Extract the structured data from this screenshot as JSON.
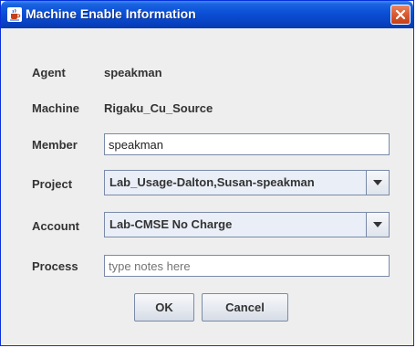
{
  "window": {
    "title": "Machine Enable Information"
  },
  "icons": {
    "title_icon": "java-cup-icon",
    "close": "close-icon",
    "dropdown": "chevron-down-icon"
  },
  "fields": {
    "agent": {
      "label": "Agent",
      "value": "speakman"
    },
    "machine": {
      "label": "Machine",
      "value": "Rigaku_Cu_Source"
    },
    "member": {
      "label": "Member",
      "value": "speakman"
    },
    "project": {
      "label": "Project",
      "selected": "Lab_Usage-Dalton,Susan-speakman"
    },
    "account": {
      "label": "Account",
      "selected": "Lab-CMSE No Charge"
    },
    "process": {
      "label": "Process",
      "value": "",
      "placeholder": "type notes here"
    }
  },
  "buttons": {
    "ok": "OK",
    "cancel": "Cancel"
  },
  "colors": {
    "titlebar": "#0a4fd6",
    "close_button": "#d85a30",
    "dialog_background": "#eeeeee"
  }
}
